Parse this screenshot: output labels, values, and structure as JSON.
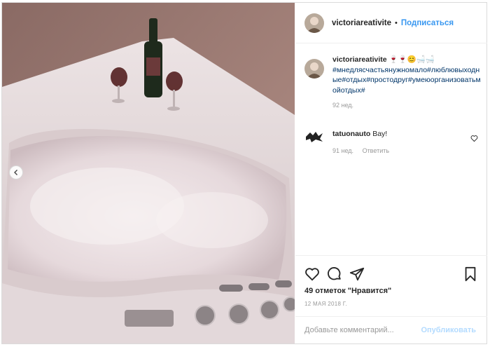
{
  "header": {
    "username": "victoriareativite",
    "separator": "•",
    "follow_label": "Подписаться"
  },
  "caption": {
    "username": "victoriareativite",
    "emoji": "🍷🍷😊🛁🛁",
    "hashtags": "#мнедлясчастьянужномало#люблювыходные#отдых#простодруг#умеюорганизоватьмойотдых#",
    "age": "92 нед."
  },
  "comment": {
    "username": "tatuonauto",
    "text": "Вау!",
    "age": "91 нед.",
    "reply_label": "Ответить"
  },
  "actions": {
    "likes": "49 отметок \"Нравится\"",
    "date": "12 МАЯ 2018 Г."
  },
  "add_comment": {
    "placeholder": "Добавьте комментарий...",
    "publish_label": "Опубликовать"
  },
  "icons": {
    "like": "heart-icon",
    "comment": "comment-bubble-icon",
    "share": "paper-plane-icon",
    "save": "bookmark-icon",
    "carousel": "chevron-left-icon"
  },
  "colors": {
    "link_blue": "#3897f0",
    "publish_disabled": "#b3dbff",
    "meta_gray": "#999999"
  }
}
